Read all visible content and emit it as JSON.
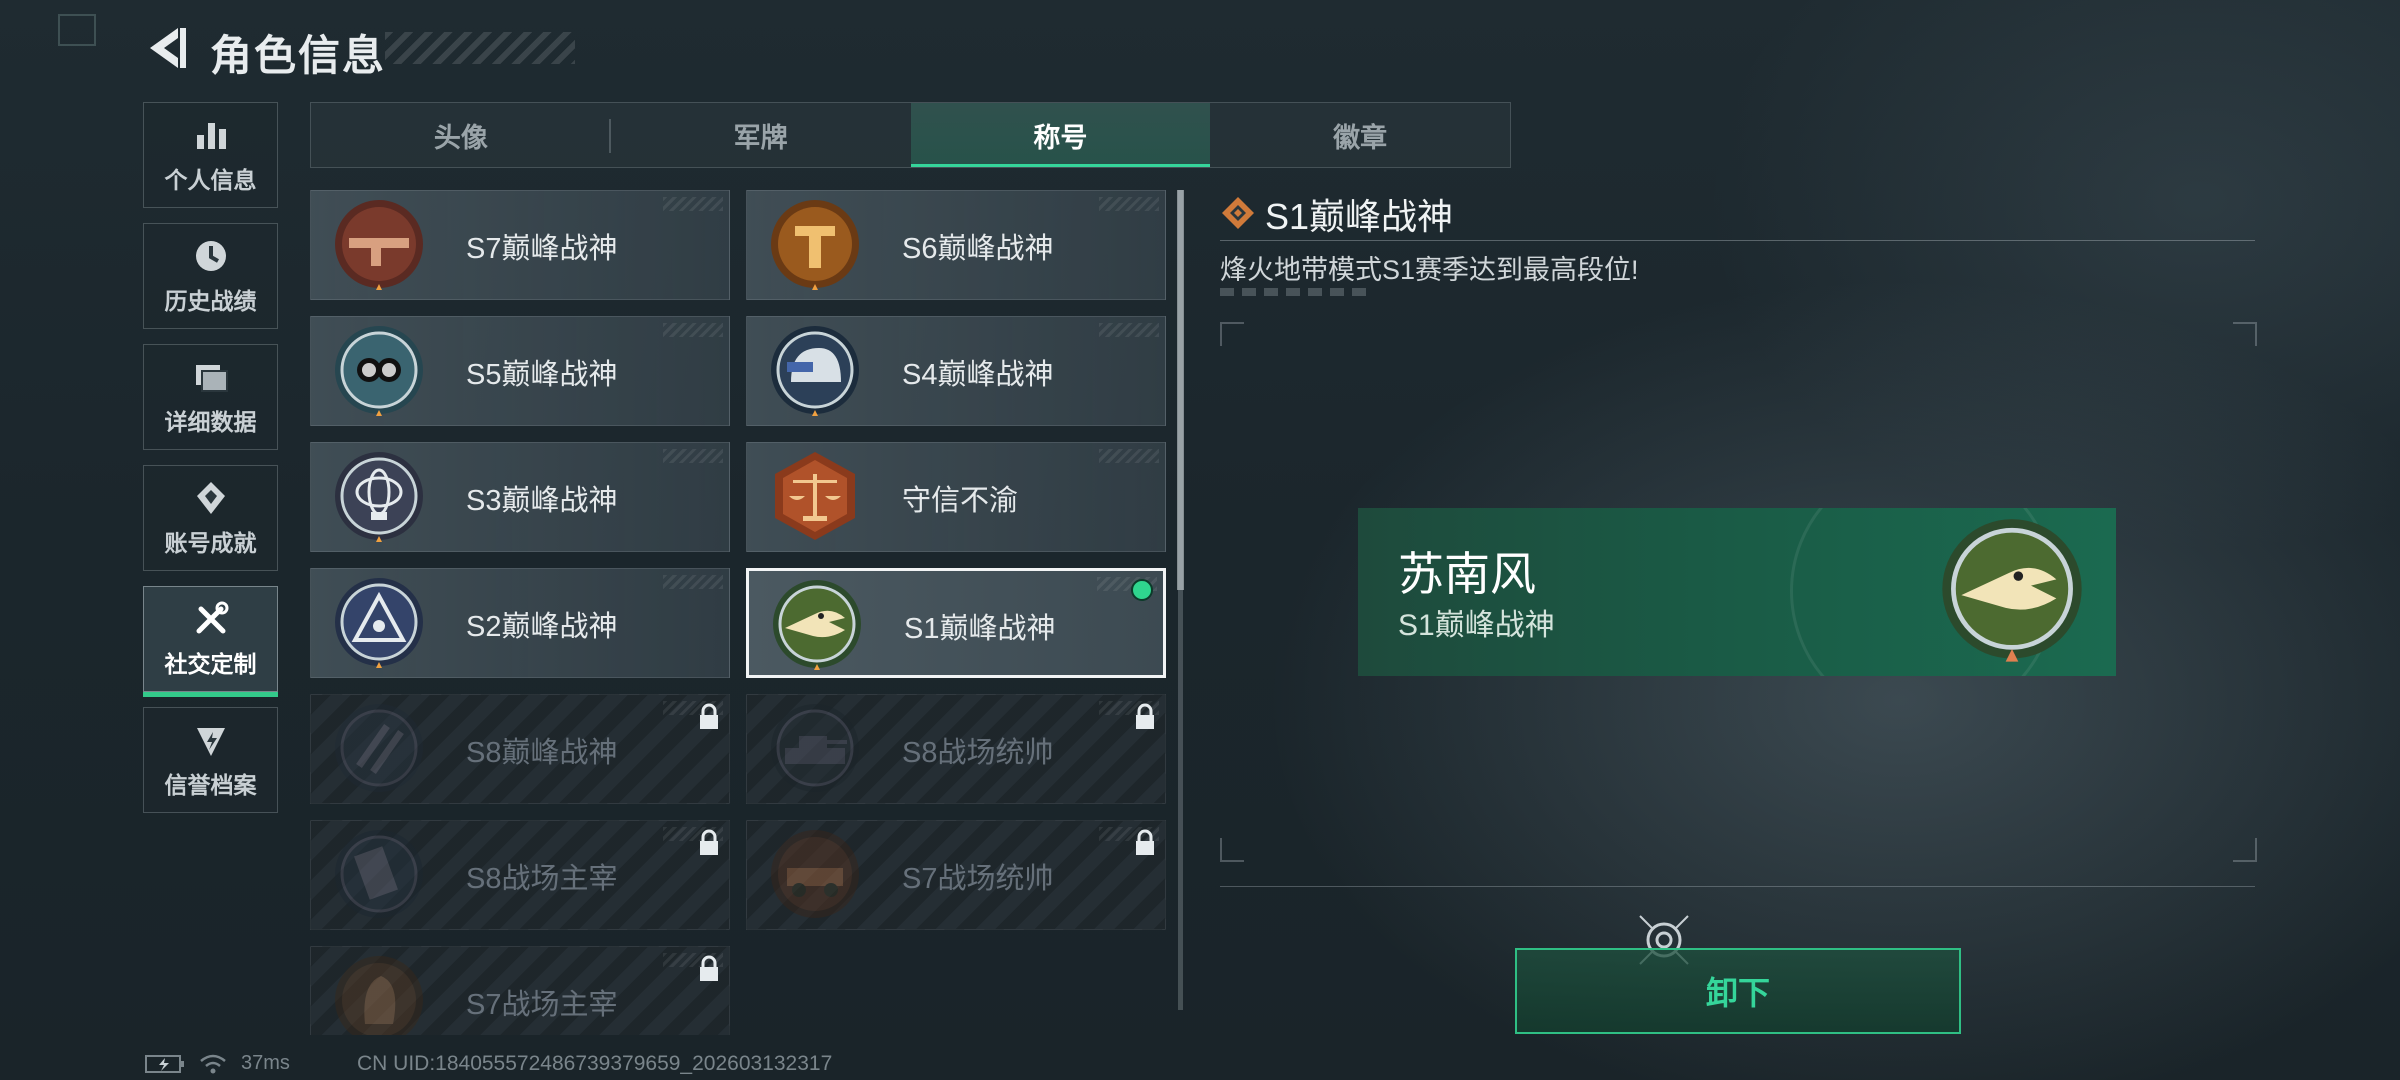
{
  "header": {
    "title": "角色信息"
  },
  "nav": [
    {
      "label": "个人信息",
      "icon": "bar-chart-icon"
    },
    {
      "label": "历史战绩",
      "icon": "history-clock-icon"
    },
    {
      "label": "详细数据",
      "icon": "folder-icon"
    },
    {
      "label": "账号成就",
      "icon": "achievement-icon"
    },
    {
      "label": "社交定制",
      "icon": "tools-icon",
      "active": true
    },
    {
      "label": "信誉档案",
      "icon": "credit-badge-icon"
    }
  ],
  "tabs": [
    {
      "label": "头像"
    },
    {
      "label": "军牌"
    },
    {
      "label": "称号",
      "active": true
    },
    {
      "label": "徽章"
    }
  ],
  "titles": [
    {
      "label": "S7巅峰战神",
      "emblem": "weapon-emblem-icon",
      "locked": false
    },
    {
      "label": "S6巅峰战神",
      "emblem": "t-shield-emblem-icon",
      "locked": false
    },
    {
      "label": "S5巅峰战神",
      "emblem": "diving-mask-emblem-icon",
      "locked": false
    },
    {
      "label": "S4巅峰战神",
      "emblem": "helmet-emblem-icon",
      "locked": false
    },
    {
      "label": "S3巅峰战神",
      "emblem": "armillary-emblem-icon",
      "locked": false
    },
    {
      "label": "守信不渝",
      "emblem": "scales-emblem-icon",
      "locked": false
    },
    {
      "label": "S2巅峰战神",
      "emblem": "triangle-emblem-icon",
      "locked": false
    },
    {
      "label": "S1巅峰战神",
      "emblem": "crocodile-emblem-icon",
      "locked": false,
      "selected": true,
      "equipped": true
    },
    {
      "label": "S8巅峰战神",
      "emblem": "slash-emblem-icon",
      "locked": true
    },
    {
      "label": "S8战场统帅",
      "emblem": "tank-emblem-icon",
      "locked": true
    },
    {
      "label": "S8战场主宰",
      "emblem": "building-emblem-icon",
      "locked": true
    },
    {
      "label": "S7战场统帅",
      "emblem": "vehicle-emblem-icon",
      "locked": true
    },
    {
      "label": "S7战场主宰",
      "emblem": "soldier-emblem-icon",
      "locked": true
    }
  ],
  "detail": {
    "title": "S1巅峰战神",
    "description": "烽火地带模式S1赛季达到最高段位!"
  },
  "preview": {
    "player_name": "苏南风",
    "title": "S1巅峰战神"
  },
  "actions": {
    "unequip_label": "卸下"
  },
  "status": {
    "ping": "37ms",
    "uid": "CN UID:18405557248673937965​9_202603132317"
  },
  "colors": {
    "accent": "#35d59a",
    "equipped": "#2fd58e",
    "preview_bg": "#1b6a50"
  }
}
